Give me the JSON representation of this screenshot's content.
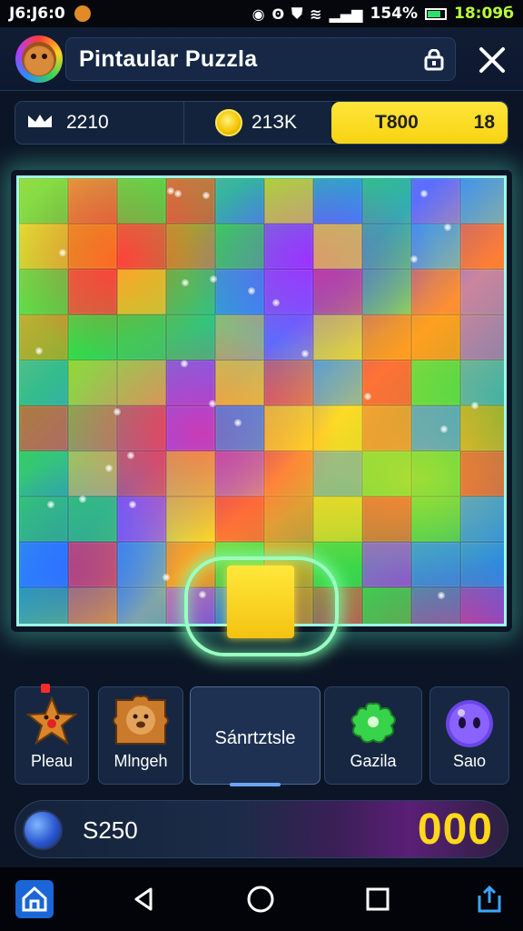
{
  "status_bar": {
    "time_left": "J6:J6:0",
    "battery": "154%",
    "time_right": "18:09б"
  },
  "header": {
    "title": "Pintaular Puzzla",
    "avatar_icon": "bear-avatar-icon",
    "lock_icon": "lock-icon",
    "close_icon": "close-icon"
  },
  "stats": {
    "moves": "2210",
    "moves_icon": "crown-icon",
    "coins": "21ЗK",
    "coins_icon": "coin-icon",
    "highlight_left": "T800",
    "highlight_right": "18"
  },
  "board": {
    "colors": [
      "#ff3b3b",
      "#ffd51f",
      "#35d84b",
      "#2f8cff",
      "#a13cff",
      "#ff7a1a"
    ]
  },
  "tray": {
    "items": [
      {
        "label": "Pleau",
        "icon": "star-piece-icon"
      },
      {
        "label": "Mlngeh",
        "icon": "bear-piece-icon"
      },
      {
        "label": "Sánrtztsle",
        "icon": ""
      },
      {
        "label": "Gazila",
        "icon": "green-splat-icon"
      },
      {
        "label": "Saιo",
        "icon": "purple-ball-icon"
      }
    ]
  },
  "scorebar": {
    "left_value": "S250",
    "right_value": "000"
  },
  "navbar": {
    "icons": [
      "home-icon",
      "back-icon",
      "circle-home-icon",
      "recents-icon",
      "share-icon"
    ]
  }
}
